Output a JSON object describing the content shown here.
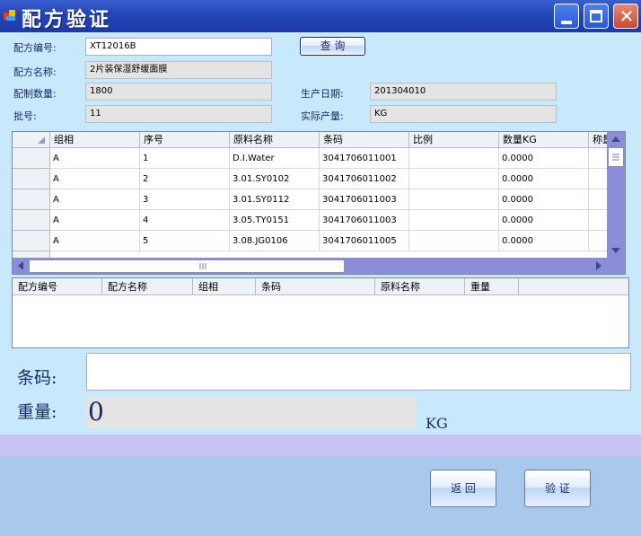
{
  "window": {
    "title": "配方验证",
    "close_glyph": "✕"
  },
  "form": {
    "recipe_code": {
      "label": "配方编号:",
      "value": "XT12016B"
    },
    "query_button": "查 询",
    "recipe_name": {
      "label": "配方名称:",
      "value": "2片装保湿舒缓面膜"
    },
    "batch_qty": {
      "label": "配制数量:",
      "value": "1800"
    },
    "production_date": {
      "label": "生产日期:",
      "value": "201304010"
    },
    "lot_no": {
      "label": "批号:",
      "value": "11"
    },
    "actual_output": {
      "label": "实际产量:",
      "value": "KG"
    }
  },
  "ingredient_grid": {
    "columns": [
      "组相",
      "序号",
      "原料名称",
      "条码",
      "比例",
      "数量KG",
      "称量"
    ],
    "rows": [
      [
        "A",
        "1",
        "D.I.Water",
        "3041706011001",
        "",
        "0.0000",
        ""
      ],
      [
        "A",
        "2",
        "3.01.SY0102",
        "3041706011002",
        "",
        "0.0000",
        ""
      ],
      [
        "A",
        "3",
        "3.01.SY0112",
        "3041706011003",
        "",
        "0.0000",
        ""
      ],
      [
        "A",
        "4",
        "3.05.TY0151",
        "3041706011003",
        "",
        "0.0000",
        ""
      ],
      [
        "A",
        "5",
        "3.08.JG0106",
        "3041706011005",
        "",
        "0.0000",
        ""
      ]
    ]
  },
  "record_grid": {
    "columns": [
      "配方编号",
      "配方名称",
      "组相",
      "条码",
      "原料名称",
      "重量"
    ]
  },
  "scan": {
    "barcode_label": "条码:",
    "barcode_value": "",
    "weight_label": "重量:",
    "weight_value": "0",
    "unit": "KG"
  },
  "buttons": {
    "back": "返 回",
    "verify": "验 证"
  },
  "colors": {
    "titlebar": "#2448b8",
    "background": "#c8e8fb",
    "scrollbar": "#8c8cd8",
    "footer": "#a8c8ec"
  }
}
